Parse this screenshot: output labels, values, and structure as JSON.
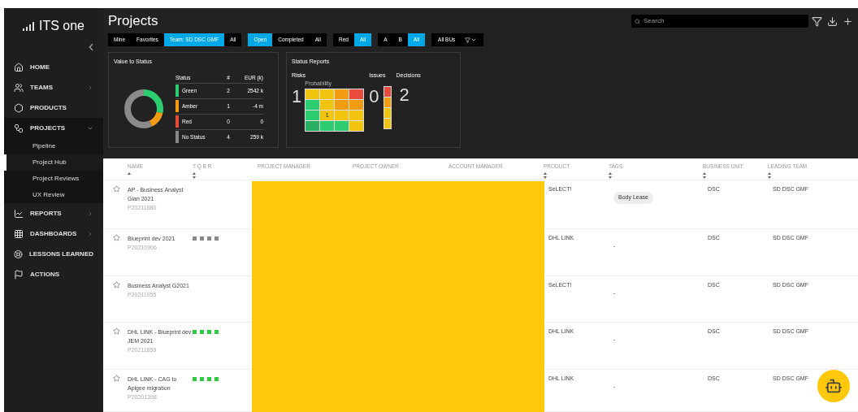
{
  "app": {
    "logo": "ITS one"
  },
  "sidebar": {
    "items": [
      {
        "label": "HOME",
        "kind": "home"
      },
      {
        "label": "TEAMS",
        "kind": "teams",
        "expanded": false
      },
      {
        "label": "PRODUCTS",
        "kind": "products"
      },
      {
        "label": "PROJECTS",
        "kind": "projects",
        "expanded": true,
        "children": [
          {
            "label": "Pipeline",
            "selected": false
          },
          {
            "label": "Project Hub",
            "selected": true
          },
          {
            "label": "Project Reviews",
            "selected": false
          },
          {
            "label": "UX Review",
            "selected": false
          }
        ]
      },
      {
        "label": "REPORTS",
        "kind": "reports",
        "expanded": false
      },
      {
        "label": "DASHBOARDS",
        "kind": "dashboards",
        "expanded": false
      },
      {
        "label": "LESSONS LEARNED",
        "kind": "lessons"
      },
      {
        "label": "ACTIONS",
        "kind": "actions"
      }
    ]
  },
  "page": {
    "title": "Projects"
  },
  "search": {
    "placeholder": "Search"
  },
  "filter_groups": [
    [
      {
        "label": "Mine",
        "selected": false
      },
      {
        "label": "Favorites",
        "selected": false
      },
      {
        "label": "Team: SD DSC GMF",
        "selected": true
      },
      {
        "label": "All",
        "selected": false
      }
    ],
    [
      {
        "label": "Open",
        "selected": true
      },
      {
        "label": "Completed",
        "selected": false
      },
      {
        "label": "All",
        "selected": false
      }
    ],
    [
      {
        "label": "Red",
        "selected": false
      },
      {
        "label": "All",
        "selected": true
      }
    ],
    [
      {
        "label": "A",
        "selected": false
      },
      {
        "label": "B",
        "selected": false
      },
      {
        "label": "All",
        "selected": true
      }
    ]
  ],
  "bu_filter": {
    "value": "All BUs"
  },
  "value_to_status": {
    "title": "Value to Status",
    "columns": [
      "Status",
      "#",
      "EUR (k)"
    ],
    "rows": [
      {
        "status": "Green",
        "count": "2",
        "value": "2542 k",
        "color": "#2ecc71"
      },
      {
        "status": "Amber",
        "count": "1",
        "value": "-4 m",
        "color": "#f39c12"
      },
      {
        "status": "Red",
        "count": "0",
        "value": "0",
        "color": "#e74c3c"
      },
      {
        "status": "No Status",
        "count": "4",
        "value": "259 k",
        "color": "#8a8a8a"
      }
    ]
  },
  "status_reports": {
    "title": "Status Reports",
    "risks": {
      "label": "Risks",
      "count": "1",
      "axis_label": "Probability",
      "grid": [
        [
          {
            "color": "#f1c40f"
          },
          {
            "color": "#f1c40f"
          },
          {
            "color": "#f39c12"
          },
          {
            "color": "#e74c3c"
          }
        ],
        [
          {
            "color": "#2ecc71"
          },
          {
            "color": "#f1c40f"
          },
          {
            "color": "#f39c12"
          },
          {
            "color": "#f39c12"
          }
        ],
        [
          {
            "color": "#2ecc71"
          },
          {
            "color": "#f1c40f",
            "text": "1"
          },
          {
            "color": "#f1c40f"
          },
          {
            "color": "#f1c40f"
          }
        ],
        [
          {
            "color": "#27ae60"
          },
          {
            "color": "#2ecc71"
          },
          {
            "color": "#2ecc71"
          },
          {
            "color": "#f1c40f"
          }
        ]
      ]
    },
    "issues": {
      "label": "Issues",
      "count": "0",
      "bar": [
        {
          "color": "#e74c3c"
        },
        {
          "color": "#f39c12"
        },
        {
          "color": "#f1c40f"
        },
        {
          "color": "#f1c40f"
        }
      ]
    },
    "decisions": {
      "label": "Decisions",
      "count": "2"
    }
  },
  "table": {
    "columns": [
      {
        "label": "NAME",
        "sorted": true
      },
      {
        "label": "T Q B R",
        "sorted": false
      },
      {
        "label": "PROJECT MANAGER"
      },
      {
        "label": "PROJECT OWNER"
      },
      {
        "label": "ACCOUNT MANAGER"
      },
      {
        "label": "PRODUCT",
        "sorted": false
      },
      {
        "label": "TAGS",
        "sorted": false
      },
      {
        "label": "BUSINESS UNIT",
        "sorted": false
      },
      {
        "label": "LEADING TEAM",
        "sorted": false
      }
    ],
    "rows": [
      {
        "name": "AP - Business Analyst Gian 2021",
        "id": "P20211880",
        "favorite": false,
        "tqbr": [],
        "product": "SeLECT!",
        "tag": "Body Lease",
        "business_unit": "DSC",
        "leading_team": "SD DSC GMF"
      },
      {
        "name": "Blueprint dev 2021",
        "id": "P20210906",
        "favorite": false,
        "tqbr": [
          {
            "color": "#888888"
          },
          {
            "color": "#888888"
          },
          {
            "color": "#888888"
          },
          {
            "color": "#888888"
          }
        ],
        "product": "DHL LINK",
        "tag": "-",
        "business_unit": "DSC",
        "leading_team": "SD DSC GMF"
      },
      {
        "name": "Business Analyst G2021",
        "id": "P20211055",
        "favorite": false,
        "tqbr": [],
        "product": "SeLECT!",
        "tag": "-",
        "business_unit": "DSC",
        "leading_team": "SD DSC GMF"
      },
      {
        "name": "DHL LINK - Blueprint dev JEM 2021",
        "id": "P20211859",
        "favorite": false,
        "tqbr": [
          {
            "color": "#2ecc40"
          },
          {
            "color": "#2ecc40"
          },
          {
            "color": "#2ecc40"
          },
          {
            "color": "#2ecc40"
          }
        ],
        "product": "DHL LINK",
        "tag": "-",
        "business_unit": "DSC",
        "leading_team": "SD DSC GMF"
      },
      {
        "name": "DHL LINK - CAG to Apigee migration",
        "id": "P20201398",
        "favorite": false,
        "tqbr": [
          {
            "color": "#2ecc40"
          },
          {
            "color": "#2ecc40"
          },
          {
            "color": "#2ecc40"
          },
          {
            "color": "#2ecc40"
          }
        ],
        "product": "DHL LINK",
        "tag": "-",
        "business_unit": "DSC",
        "leading_team": "SD DSC GMF"
      }
    ],
    "redacted": true
  }
}
